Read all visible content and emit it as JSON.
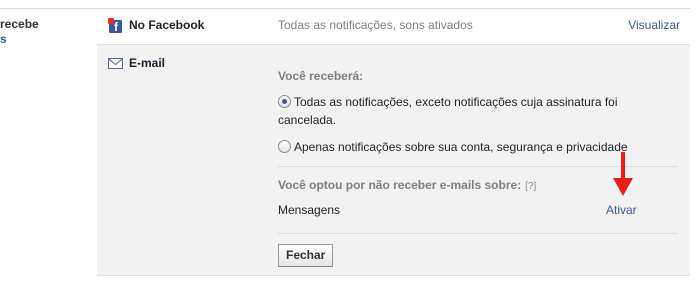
{
  "left_column": {
    "line1": "recebe",
    "line2": "s"
  },
  "facebook_row": {
    "icon": "facebook-notification-icon",
    "label": "No Facebook",
    "status": "Todas as notificações, sons ativados",
    "link": "Visualizar"
  },
  "email_panel": {
    "icon": "envelope-icon",
    "label": "E-mail",
    "receive_heading": "Você receberá:",
    "options": [
      {
        "label": "Todas as notificações, exceto notificações cuja assinatura foi cancelada.",
        "selected": true
      },
      {
        "label": "Apenas notificações sobre sua conta, segurança e privacidade",
        "selected": false
      }
    ],
    "optout_heading": "Você optou por não receber e-mails sobre:",
    "help": "[?]",
    "optout_item": "Mensagens",
    "activate_link": "Ativar",
    "close_button": "Fechar"
  },
  "annotation": {
    "icon": "red-arrow-down-icon",
    "color": "#e8201a"
  },
  "colors": {
    "link": "#3b5998",
    "panel_bg": "#f2f2f2",
    "muted_text": "#7f7f7f"
  }
}
